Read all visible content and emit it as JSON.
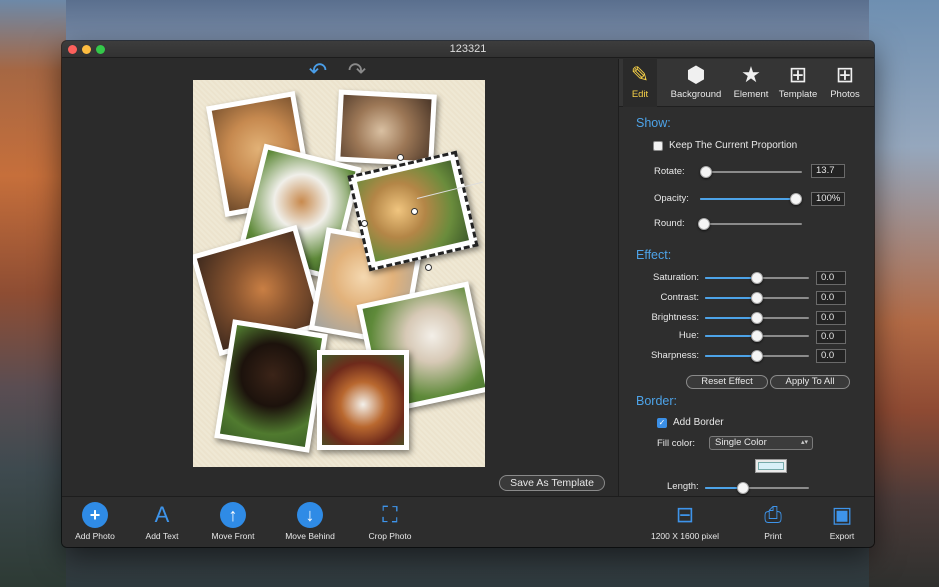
{
  "window": {
    "title": "123321"
  },
  "canvas": {
    "save_template_label": "Save As Template"
  },
  "tabs": [
    {
      "label": "Edit",
      "icon": "edit-icon",
      "active": true
    },
    {
      "label": "Background",
      "icon": "cube-icon",
      "active": false
    },
    {
      "label": "Element",
      "icon": "star-icon",
      "active": false
    },
    {
      "label": "Template",
      "icon": "template-grid-icon",
      "active": false
    },
    {
      "label": "Photos",
      "icon": "photos-grid-icon",
      "active": false
    }
  ],
  "show": {
    "title": "Show:",
    "keep_proportion_label": "Keep The Current Proportion",
    "keep_proportion_checked": false,
    "rotate": {
      "label": "Rotate:",
      "value": "13.7",
      "level": 0.04
    },
    "opacity": {
      "label": "Opacity:",
      "value": "100%",
      "level": 1.0
    },
    "round": {
      "label": "Round:",
      "level": 0.0
    }
  },
  "effect": {
    "title": "Effect:",
    "sliders": [
      {
        "label": "Saturation:",
        "value": "0.0",
        "level": 0.5
      },
      {
        "label": "Contrast:",
        "value": "0.0",
        "level": 0.5
      },
      {
        "label": "Brightness:",
        "value": "0.0",
        "level": 0.5
      },
      {
        "label": "Hue:",
        "value": "0.0",
        "level": 0.5
      },
      {
        "label": "Sharpness:",
        "value": "0.0",
        "level": 0.5
      }
    ],
    "reset_label": "Reset Effect",
    "apply_all_label": "Apply To All"
  },
  "border": {
    "title": "Border:",
    "add_border_label": "Add Border",
    "add_border_checked": true,
    "fill_color_label": "Fill color:",
    "fill_color_value": "Single Color",
    "swatch_color": "#d9f0f8",
    "length": {
      "label": "Length:",
      "level": 0.36
    }
  },
  "toolbar": {
    "add_photo": "Add Photo",
    "add_text": "Add Text",
    "move_front": "Move Front",
    "move_behind": "Move Behind",
    "crop_photo": "Crop Photo",
    "size": "1200 X 1600 pixel",
    "print": "Print",
    "export": "Export"
  },
  "colors": {
    "accent": "#4da3e8",
    "active_tab": "#f7d148",
    "panel_bg": "#2e2e2e"
  }
}
